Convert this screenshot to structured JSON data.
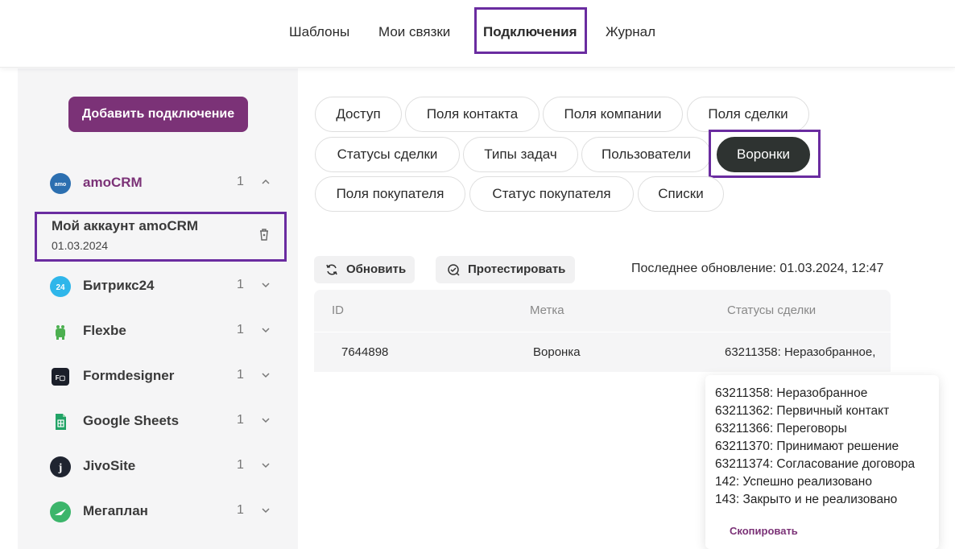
{
  "topnav": {
    "items": [
      {
        "label": "Шаблоны"
      },
      {
        "label": "Мои связки"
      },
      {
        "label": "Подключения",
        "active": true
      },
      {
        "label": "Журнал"
      }
    ]
  },
  "sidebar": {
    "add_button": "Добавить подключение",
    "connections": [
      {
        "name": "amoCRM",
        "count": "1",
        "icon": "amocrm-icon",
        "color": "#2c6fb0",
        "expanded": true
      },
      {
        "name": "Битрикс24",
        "count": "1",
        "icon": "bitrix24-icon",
        "color": "#2fb6ea"
      },
      {
        "name": "Flexbe",
        "count": "1",
        "icon": "flexbe-icon",
        "color": "#4caf50"
      },
      {
        "name": "Formdesigner",
        "count": "1",
        "icon": "formdesigner-icon",
        "color": "#1b1f2a"
      },
      {
        "name": "Google Sheets",
        "count": "1",
        "icon": "google-sheets-icon",
        "color": "#21a366"
      },
      {
        "name": "JivoSite",
        "count": "1",
        "icon": "jivosite-icon",
        "color": "#1f2430"
      },
      {
        "name": "Мегаплан",
        "count": "1",
        "icon": "megaplan-icon",
        "color": "#3cb56b"
      }
    ],
    "account": {
      "name": "Мой аккаунт amoCRM",
      "date": "01.03.2024"
    },
    "bitrix_badge": "24"
  },
  "tabs": [
    {
      "label": "Доступ"
    },
    {
      "label": "Поля контакта"
    },
    {
      "label": "Поля компании"
    },
    {
      "label": "Поля сделки"
    },
    {
      "label": "Статусы сделки"
    },
    {
      "label": "Типы задач"
    },
    {
      "label": "Пользователи"
    },
    {
      "label": "Воронки",
      "active": true
    },
    {
      "label": "Поля покупателя"
    },
    {
      "label": "Статус покупателя"
    },
    {
      "label": "Списки"
    }
  ],
  "toolbar": {
    "refresh_label": "Обновить",
    "test_label": "Протестировать",
    "last_update": "Последнее обновление: 01.03.2024, 12:47"
  },
  "table": {
    "columns": [
      "ID",
      "Метка",
      "Статусы сделки"
    ],
    "rows": [
      {
        "id": "7644898",
        "label": "Воронка",
        "statuses": "63211358: Неразобранное,"
      }
    ]
  },
  "popup": {
    "lines": [
      "63211358: Неразобранное",
      "63211362: Первичный контакт",
      "63211366: Переговоры",
      "63211370: Принимают решение",
      "63211374: Согласование договора",
      "142: Успешно реализовано",
      "143: Закрыто и не реализовано"
    ],
    "copy_label": "Скопировать"
  },
  "colors": {
    "accent": "#7b3277",
    "highlight": "#6a2ca0",
    "active_pill": "#2e3331",
    "sidebar_bg": "#f5f5f6"
  }
}
